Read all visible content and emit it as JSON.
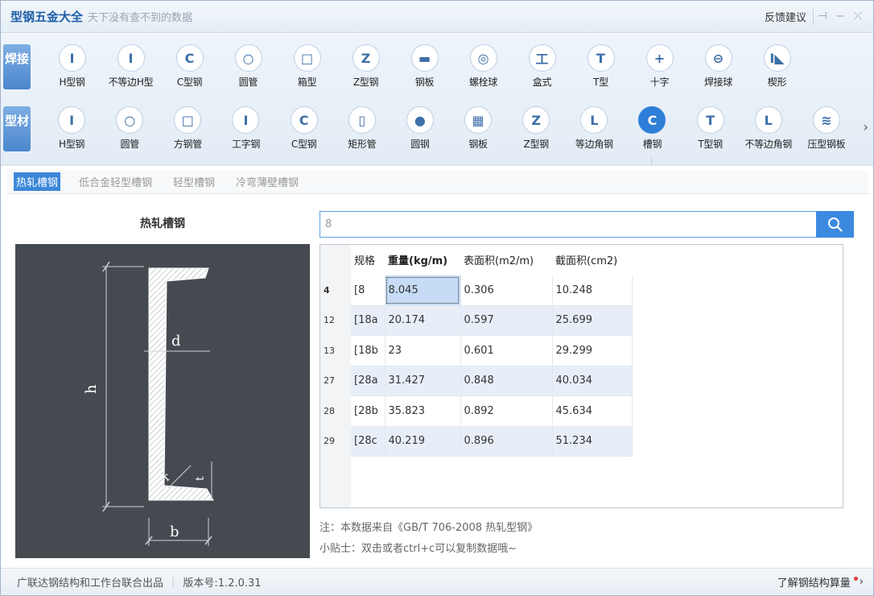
{
  "app": {
    "title": "型钢五金大全",
    "slogan": "天下没有查不到的数据",
    "feedback": "反馈建议"
  },
  "categories": {
    "weld": {
      "label": "焊接",
      "items": [
        {
          "label": "H型钢",
          "glyph": "I"
        },
        {
          "label": "不等边H型",
          "glyph": "I"
        },
        {
          "label": "C型钢",
          "glyph": "C"
        },
        {
          "label": "圆管",
          "glyph": "○"
        },
        {
          "label": "箱型",
          "glyph": "□"
        },
        {
          "label": "Z型钢",
          "glyph": "Z"
        },
        {
          "label": "钢板",
          "glyph": "▬"
        },
        {
          "label": "螺栓球",
          "glyph": "◎"
        },
        {
          "label": "盒式",
          "glyph": "工"
        },
        {
          "label": "T型",
          "glyph": "T"
        },
        {
          "label": "十字",
          "glyph": "+"
        },
        {
          "label": "焊接球",
          "glyph": "⊖"
        },
        {
          "label": "楔形",
          "glyph": "I◣"
        }
      ]
    },
    "profile": {
      "label": "型材",
      "items": [
        {
          "label": "H型钢",
          "glyph": "I"
        },
        {
          "label": "圆管",
          "glyph": "○"
        },
        {
          "label": "方钢管",
          "glyph": "□"
        },
        {
          "label": "工字钢",
          "glyph": "I"
        },
        {
          "label": "C型钢",
          "glyph": "C"
        },
        {
          "label": "矩形管",
          "glyph": "▯"
        },
        {
          "label": "圆钢",
          "glyph": "●"
        },
        {
          "label": "钢板",
          "glyph": "▦"
        },
        {
          "label": "Z型钢",
          "glyph": "Z"
        },
        {
          "label": "等边角钢",
          "glyph": "L"
        },
        {
          "label": "槽钢",
          "glyph": "C",
          "active": true
        },
        {
          "label": "T型钢",
          "glyph": "T"
        },
        {
          "label": "不等边角钢",
          "glyph": "L"
        },
        {
          "label": "压型钢板",
          "glyph": "≋"
        }
      ]
    }
  },
  "subtabs": [
    {
      "label": "热轧槽钢",
      "active": true
    },
    {
      "label": "低合金轻型槽钢"
    },
    {
      "label": "轻型槽钢"
    },
    {
      "label": "冷弯薄壁槽钢"
    }
  ],
  "diagram": {
    "title": "热轧槽钢",
    "labels": {
      "h": "h",
      "b": "b",
      "d": "d",
      "t": "t",
      "r": "r"
    }
  },
  "search": {
    "value": "8"
  },
  "table": {
    "headers": [
      "规格",
      "重量(kg/m)",
      "表面积(m2/m)",
      "截面积(cm2)"
    ],
    "rows": [
      {
        "rownum": "4",
        "cells": [
          "[8",
          "8.045",
          "0.306",
          "10.248"
        ]
      },
      {
        "rownum": "12",
        "cells": [
          "[18a",
          "20.174",
          "0.597",
          "25.699"
        ]
      },
      {
        "rownum": "13",
        "cells": [
          "[18b",
          "23",
          "0.601",
          "29.299"
        ]
      },
      {
        "rownum": "27",
        "cells": [
          "[28a",
          "31.427",
          "0.848",
          "40.034"
        ]
      },
      {
        "rownum": "28",
        "cells": [
          "[28b",
          "35.823",
          "0.892",
          "45.634"
        ]
      },
      {
        "rownum": "29",
        "cells": [
          "[28c",
          "40.219",
          "0.896",
          "51.234"
        ]
      }
    ]
  },
  "notes": {
    "source": "注：本数据来自《GB/T  706-2008 热轧型钢》",
    "tip": "小贴士：双击或者ctrl+c可以复制数据哦~"
  },
  "footer": {
    "publisher": "广联达钢结构和工作台联合出品",
    "version": "版本号:1.2.0.31",
    "learn_more": "了解钢结构算量"
  },
  "colors": {
    "accent": "#3b87d8",
    "active_icon": "#2f7fd9",
    "diagram_bg": "#454a51"
  }
}
